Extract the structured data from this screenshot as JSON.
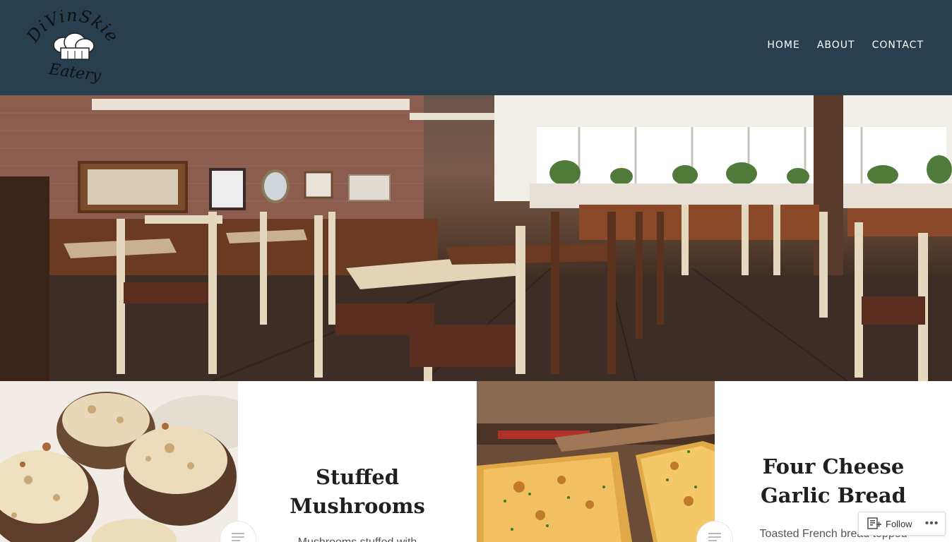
{
  "site": {
    "logo_text_top": "DiVinSkie",
    "logo_text_bottom": "Eatery",
    "header_color": "#263e4e"
  },
  "nav": {
    "items": [
      {
        "label": "HOME"
      },
      {
        "label": "ABOUT"
      },
      {
        "label": "CONTACT"
      }
    ]
  },
  "posts": [
    {
      "title_line1": "Stuffed",
      "title_line2": "Mushrooms",
      "excerpt": "Mushrooms stuffed with",
      "image": "stuffed-mushrooms-photo"
    },
    {
      "title_line1": "Four Cheese",
      "title_line2": "Garlic Bread",
      "excerpt": "Toasted French bread topped",
      "image": "garlic-bread-photo"
    }
  ],
  "follow_widget": {
    "label": "Follow",
    "icon": "reader-follow-icon",
    "more_icon": "ellipsis-icon"
  }
}
